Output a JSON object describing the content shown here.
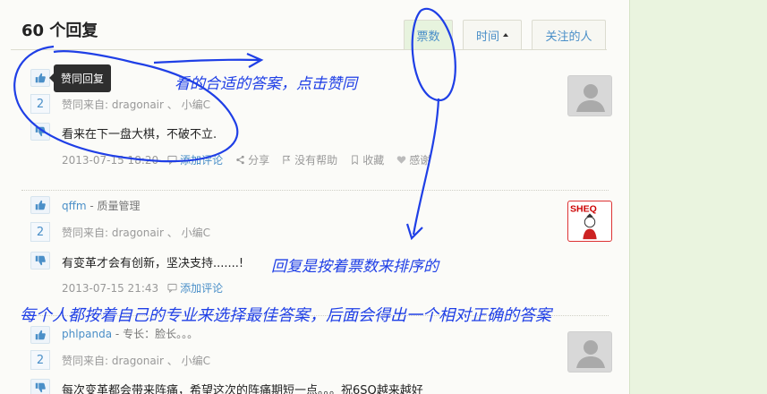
{
  "header": {
    "answers_count": "60 个回复",
    "tabs": [
      {
        "label": "票数",
        "active": true
      },
      {
        "label": "时间",
        "active": false
      },
      {
        "label": "关注的人",
        "active": false
      }
    ]
  },
  "tooltip": "赞同回复",
  "answers": [
    {
      "author": "",
      "title": "",
      "votes": "2",
      "voters": "赞同来自: dragonair 、 小编C",
      "content": "看来在下一盘大棋，不破不立.",
      "date": "2013-07-15 18:20",
      "actions": [
        "添加评论",
        "分享",
        "没有帮助",
        "收藏",
        "感谢"
      ],
      "avatar": "default"
    },
    {
      "author": "qffm",
      "title": " - 质量管理",
      "votes": "2",
      "voters": "赞同来自: dragonair 、 小编C",
      "content": "有变革才会有创新，坚决支持.......!",
      "date": "2013-07-15 21:43",
      "actions": [
        "添加评论"
      ],
      "avatar": "sheq",
      "avatar_text": "SHEQ"
    },
    {
      "author": "phlpanda",
      "title": " - 专长：脸长。。。",
      "votes": "2",
      "voters": "赞同来自: dragonair 、 小编C",
      "content": "每次变革都会带来阵痛，希望这次的阵痛期短一点。。。祝6SQ越来越好",
      "avatar": "default"
    }
  ],
  "annotations": {
    "a1": "看的合适的答案，点击赞同",
    "a2": "回复是按着票数来排序的",
    "a3": "每个人都按着自己的专业来选择最佳答案，后面会得出一个相对正确的答案"
  },
  "colors": {
    "link": "#4a8fc8",
    "annotation": "#1f3fe6",
    "right_panel": "#eaf4df"
  }
}
